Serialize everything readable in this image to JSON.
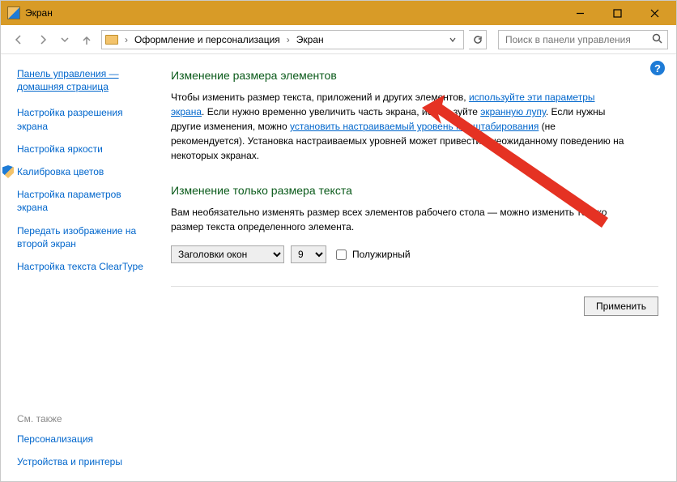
{
  "window": {
    "title": "Экран"
  },
  "breadcrumbs": {
    "part1": "Оформление и персонализация",
    "part2": "Экран"
  },
  "search": {
    "placeholder": "Поиск в панели управления"
  },
  "sidebar": {
    "home": "Панель управления — домашняя страница",
    "links": [
      "Настройка разрешения экрана",
      "Настройка яркости",
      "Калибровка цветов",
      "Настройка параметров экрана",
      "Передать изображение на второй экран",
      "Настройка текста ClearType"
    ],
    "seeAlsoHeading": "См. также",
    "seeAlso": [
      "Персонализация",
      "Устройства и принтеры"
    ]
  },
  "main": {
    "heading1": "Изменение размера элементов",
    "para1_a": "Чтобы изменить размер текста, приложений и других элементов, ",
    "link1": "используйте эти параметры экрана",
    "para1_b": ". Если нужно временно увеличить часть экрана, используйте ",
    "link2": "экранную лупу",
    "para1_c": ". Если нужны другие изменения, можно ",
    "link3": "установить настраиваемый уровень масштабирования",
    "para1_d": " (не рекомендуется). Установка настраиваемых уровней может привести к неожиданному поведению на некоторых экранах.",
    "heading2": "Изменение только размера текста",
    "para2": "Вам необязательно изменять размер всех элементов рабочего стола — можно изменить только размер текста определенного элемента.",
    "dropdown1": {
      "options": [
        "Заголовки окон"
      ],
      "selected": "Заголовки окон"
    },
    "dropdown2": {
      "options": [
        "9"
      ],
      "selected": "9"
    },
    "boldLabel": "Полужирный",
    "applyLabel": "Применить"
  }
}
